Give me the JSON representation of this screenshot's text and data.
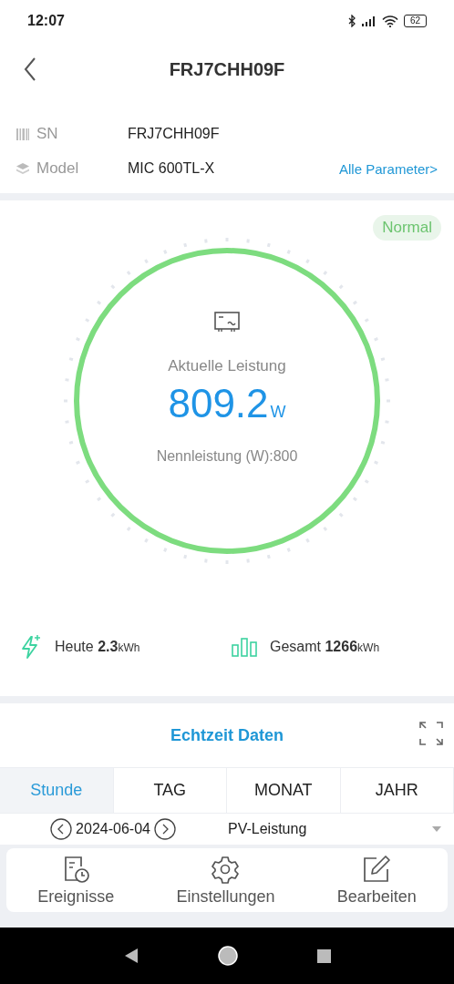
{
  "status_bar": {
    "time": "12:07",
    "battery": "62"
  },
  "header": {
    "title": "FRJ7CHH09F"
  },
  "info": [
    {
      "kind": "sn",
      "label": "SN",
      "value": "FRJ7CHH09F"
    },
    {
      "kind": "model",
      "label": "Model",
      "value": "MIC 600TL-X",
      "link": "Alle Parameter>"
    }
  ],
  "gauge": {
    "status": "Normal",
    "label": "Aktuelle Leistung",
    "value": "809.2",
    "unit": "W",
    "rated": "Nennleistung (W):800",
    "level": 1
  },
  "stats": [
    {
      "kind": "today",
      "label": "Heute",
      "value": "2.3",
      "unit": "kWh"
    },
    {
      "kind": "total",
      "label": "Gesamt",
      "value": "1266",
      "unit": "kWh"
    }
  ],
  "realtime": {
    "title": "Echtzeit Daten",
    "tabs": [
      {
        "label": "Stunde",
        "selected": true
      },
      {
        "label": "TAG",
        "selected": false
      },
      {
        "label": "MONAT",
        "selected": false
      },
      {
        "label": "JAHR",
        "selected": false
      }
    ],
    "date": "2024-06-04",
    "metric": "PV-Leistung"
  },
  "bottom_nav": [
    {
      "kind": "events",
      "label": "Ereignisse"
    },
    {
      "kind": "settings",
      "label": "Einstellungen"
    },
    {
      "kind": "edit",
      "label": "Bearbeiten"
    }
  ]
}
